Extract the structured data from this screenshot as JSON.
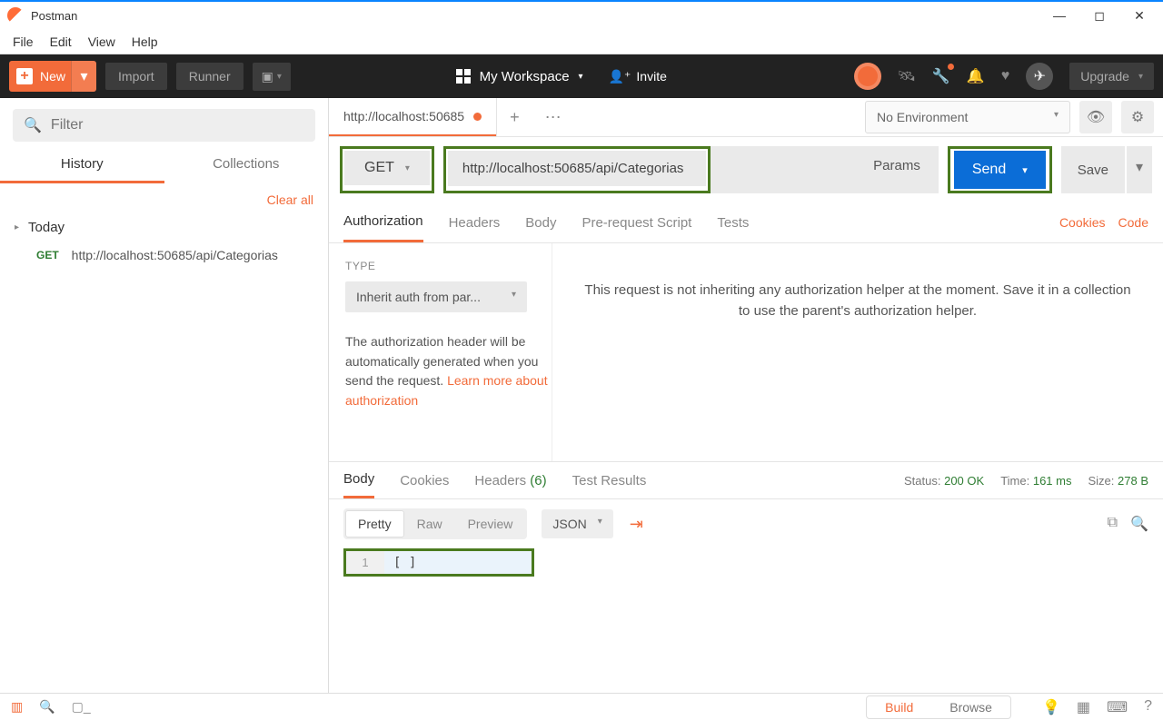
{
  "window": {
    "title": "Postman"
  },
  "menu": {
    "file": "File",
    "edit": "Edit",
    "view": "View",
    "help": "Help"
  },
  "toolbar": {
    "new": "New",
    "import": "Import",
    "runner": "Runner",
    "workspace": "My Workspace",
    "invite": "Invite",
    "upgrade": "Upgrade"
  },
  "sidebar": {
    "filter_placeholder": "Filter",
    "tab_history": "History",
    "tab_collections": "Collections",
    "clear": "Clear all",
    "group": "Today",
    "items": [
      {
        "method": "GET",
        "url": "http://localhost:50685/api/Categorias"
      }
    ]
  },
  "request": {
    "tab_label": "http://localhost:50685",
    "method": "GET",
    "url": "http://localhost:50685/api/Categorias",
    "params": "Params",
    "send": "Send",
    "save": "Save",
    "env": "No Environment",
    "tabs": {
      "auth": "Authorization",
      "headers": "Headers",
      "body": "Body",
      "pre": "Pre-request Script",
      "tests": "Tests"
    },
    "cookies": "Cookies",
    "code": "Code",
    "auth": {
      "type_label": "TYPE",
      "type_value": "Inherit auth from par...",
      "desc": "The authorization header will be automatically generated when you send the request.",
      "learn": "Learn more about authorization",
      "right": "This request is not inheriting any authorization helper at the moment. Save it in a collection to use the parent's authorization helper."
    }
  },
  "response": {
    "tabs": {
      "body": "Body",
      "cookies": "Cookies",
      "headers": "Headers",
      "headers_count": "(6)",
      "tests": "Test Results"
    },
    "status_lbl": "Status:",
    "status_val": "200 OK",
    "time_lbl": "Time:",
    "time_val": "161 ms",
    "size_lbl": "Size:",
    "size_val": "278 B",
    "views": {
      "pretty": "Pretty",
      "raw": "Raw",
      "preview": "Preview"
    },
    "format": "JSON",
    "body_line": "1",
    "body_text": "[ ]"
  },
  "statusbar": {
    "build": "Build",
    "browse": "Browse"
  }
}
